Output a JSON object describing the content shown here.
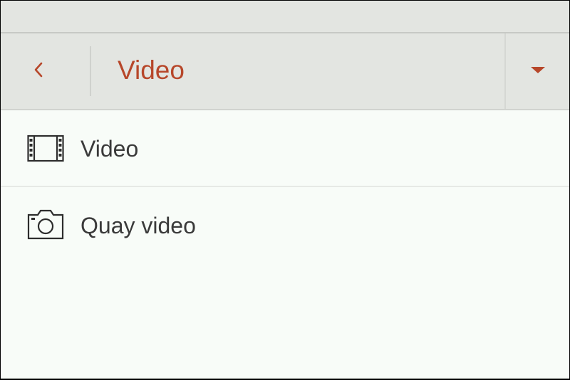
{
  "header": {
    "title": "Video",
    "accent_color": "#b7472a",
    "back_icon": "chevron-left-icon",
    "dropdown_icon": "caret-down-icon"
  },
  "menu": {
    "items": [
      {
        "label": "Video",
        "icon": "film-strip-icon"
      },
      {
        "label": "Quay video",
        "icon": "camera-icon"
      }
    ]
  }
}
